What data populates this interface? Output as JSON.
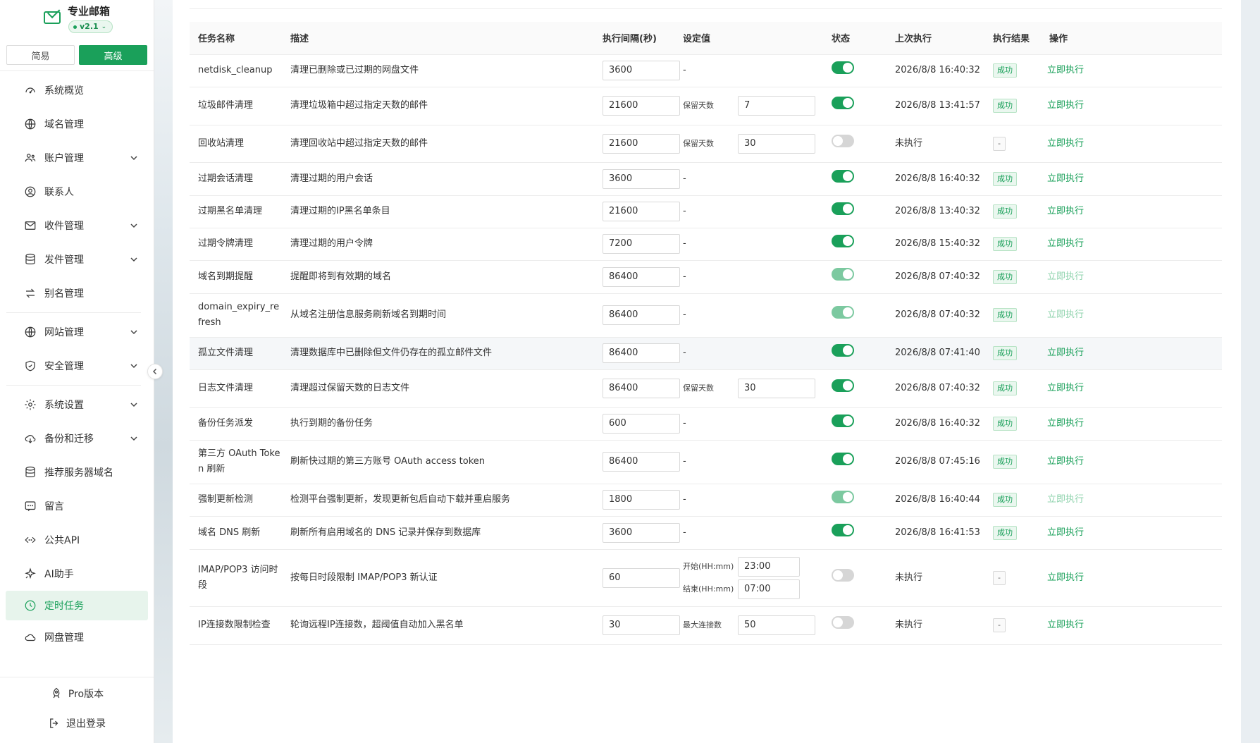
{
  "brand": {
    "title": "专业邮箱",
    "version": "v2.1"
  },
  "mode": {
    "simple": "简易",
    "advanced": "高级"
  },
  "nav": [
    {
      "label": "系统概览",
      "icon": "dashboard-icon",
      "expandable": false
    },
    {
      "label": "域名管理",
      "icon": "globe-icon",
      "expandable": false
    },
    {
      "label": "账户管理",
      "icon": "users-icon",
      "expandable": true
    },
    {
      "label": "联系人",
      "icon": "contact-icon",
      "expandable": false
    },
    {
      "label": "收件管理",
      "icon": "mail-icon",
      "expandable": true
    },
    {
      "label": "发件管理",
      "icon": "database-icon",
      "expandable": true
    },
    {
      "label": "别名管理",
      "icon": "swap-icon",
      "expandable": false
    },
    {
      "label": "网站管理",
      "icon": "globe-icon",
      "expandable": true
    },
    {
      "label": "安全管理",
      "icon": "shield-icon",
      "expandable": true
    },
    {
      "label": "系统设置",
      "icon": "gear-icon",
      "expandable": true
    },
    {
      "label": "备份和迁移",
      "icon": "cloud-download-icon",
      "expandable": true
    },
    {
      "label": "推荐服务器域名",
      "icon": "database-icon",
      "expandable": false
    },
    {
      "label": "留言",
      "icon": "message-icon",
      "expandable": false
    },
    {
      "label": "公共API",
      "icon": "code-icon",
      "expandable": false
    },
    {
      "label": "AI助手",
      "icon": "sparkle-icon",
      "expandable": false
    },
    {
      "label": "定时任务",
      "icon": "clock-icon",
      "expandable": false,
      "active": true
    },
    {
      "label": "网盘管理",
      "icon": "cloud-icon",
      "expandable": false
    }
  ],
  "footer": {
    "pro": "Pro版本",
    "logout": "退出登录"
  },
  "table": {
    "headers": [
      "任务名称",
      "描述",
      "执行间隔(秒)",
      "设定值",
      "状态",
      "上次执行",
      "执行结果",
      "操作"
    ],
    "rows": [
      {
        "name": "netdisk_cleanup",
        "desc": "清理已删除或已过期的网盘文件",
        "interval": "3600",
        "setting": "-",
        "status": "on",
        "last": "2026/8/8 16:40:32",
        "result": "成功",
        "action": "立即执行"
      },
      {
        "name": "垃圾邮件清理",
        "desc": "清理垃圾箱中超过指定天数的邮件",
        "interval": "21600",
        "setting_label": "保留天数",
        "setting_value": "7",
        "status": "on",
        "last": "2026/8/8 13:41:57",
        "result": "成功",
        "action": "立即执行"
      },
      {
        "name": "回收站清理",
        "desc": "清理回收站中超过指定天数的邮件",
        "interval": "21600",
        "setting_label": "保留天数",
        "setting_value": "30",
        "status": "off",
        "last": "未执行",
        "result": "-",
        "action": "立即执行"
      },
      {
        "name": "过期会话清理",
        "desc": "清理过期的用户会话",
        "interval": "3600",
        "setting": "-",
        "status": "on",
        "last": "2026/8/8 16:40:32",
        "result": "成功",
        "action": "立即执行"
      },
      {
        "name": "过期黑名单清理",
        "desc": "清理过期的IP黑名单条目",
        "interval": "21600",
        "setting": "-",
        "status": "on",
        "last": "2026/8/8 13:40:32",
        "result": "成功",
        "action": "立即执行"
      },
      {
        "name": "过期令牌清理",
        "desc": "清理过期的用户令牌",
        "interval": "7200",
        "setting": "-",
        "status": "on",
        "last": "2026/8/8 15:40:32",
        "result": "成功",
        "action": "立即执行"
      },
      {
        "name": "域名到期提醒",
        "desc": "提醒即将到有效期的域名",
        "interval": "86400",
        "setting": "-",
        "status": "dim",
        "last": "2026/8/8 07:40:32",
        "result": "成功",
        "action": "立即执行"
      },
      {
        "name": "domain_expiry_refresh",
        "desc": "从域名注册信息服务刷新域名到期时间",
        "interval": "86400",
        "setting": "-",
        "status": "dim",
        "last": "2026/8/8 07:40:32",
        "result": "成功",
        "action": "立即执行"
      },
      {
        "name": "孤立文件清理",
        "desc": "清理数据库中已删除但文件仍存在的孤立邮件文件",
        "interval": "86400",
        "setting": "-",
        "status": "on",
        "last": "2026/8/8 07:41:40",
        "result": "成功",
        "action": "立即执行"
      },
      {
        "name": "日志文件清理",
        "desc": "清理超过保留天数的日志文件",
        "interval": "86400",
        "setting_label": "保留天数",
        "setting_value": "30",
        "status": "on",
        "last": "2026/8/8 07:40:32",
        "result": "成功",
        "action": "立即执行"
      },
      {
        "name": "备份任务派发",
        "desc": "执行到期的备份任务",
        "interval": "600",
        "setting": "-",
        "status": "on",
        "last": "2026/8/8 16:40:32",
        "result": "成功",
        "action": "立即执行"
      },
      {
        "name": "第三方 OAuth Token 刷新",
        "desc": "刷新快过期的第三方账号 OAuth access token",
        "interval": "86400",
        "setting": "-",
        "status": "on",
        "last": "2026/8/8 07:45:16",
        "result": "成功",
        "action": "立即执行"
      },
      {
        "name": "强制更新检测",
        "desc": "检测平台强制更新，发现更新包后自动下载并重启服务",
        "interval": "1800",
        "setting": "-",
        "status": "dim",
        "last": "2026/8/8 16:40:44",
        "result": "成功",
        "action": "立即执行"
      },
      {
        "name": "域名 DNS 刷新",
        "desc": "刷新所有启用域名的 DNS 记录并保存到数据库",
        "interval": "3600",
        "setting": "-",
        "status": "on",
        "last": "2026/8/8 16:41:53",
        "result": "成功",
        "action": "立即执行"
      },
      {
        "name": "IMAP/POP3 访问时段",
        "desc": "按每日时段限制 IMAP/POP3 新认证",
        "interval": "60",
        "setting_start_label": "开始(HH:mm)",
        "setting_start": "23:00",
        "setting_end_label": "结束(HH:mm)",
        "setting_end": "07:00",
        "status": "off",
        "last": "未执行",
        "result": "-",
        "action": "立即执行"
      },
      {
        "name": "IP连接数限制检查",
        "desc": "轮询远程IP连接数，超阈值自动加入黑名单",
        "interval": "30",
        "setting_label": "最大连接数",
        "setting_value": "50",
        "status": "off",
        "last": "未执行",
        "result": "-",
        "action": "立即执行"
      }
    ]
  },
  "colors": {
    "accent": "#1aa05a",
    "accent_light": "#eaf7ef"
  }
}
